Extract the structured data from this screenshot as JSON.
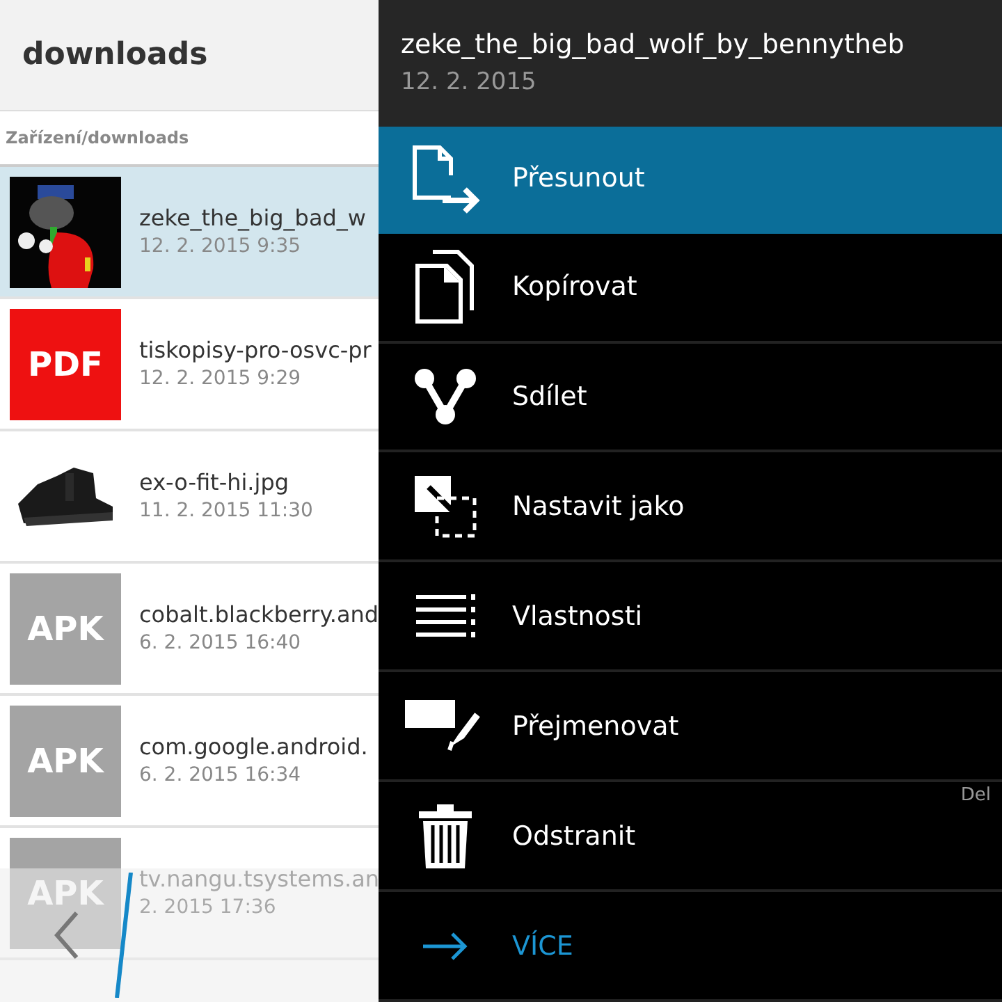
{
  "header": {
    "title": "downloads"
  },
  "breadcrumb": "Zařízení/downloads",
  "files": [
    {
      "kind": "picture",
      "name": "zeke_the_big_bad_w",
      "date": "12. 2. 2015 9:35",
      "selected": true
    },
    {
      "kind": "tile",
      "tile": "PDF",
      "color": "#ee1111",
      "name": "tiskopisy-pro-osvc-pr",
      "date": "12. 2. 2015 9:29",
      "selected": false
    },
    {
      "kind": "picture",
      "name": "ex-o-fit-hi.jpg",
      "date": "11. 2. 2015 11:30",
      "selected": false
    },
    {
      "kind": "tile",
      "tile": "APK",
      "color": "#a4a4a4",
      "name": "cobalt.blackberry.and",
      "date": "6. 2. 2015 16:40",
      "selected": false
    },
    {
      "kind": "tile",
      "tile": "APK",
      "color": "#a4a4a4",
      "name": "com.google.android.",
      "date": "6. 2. 2015 16:34",
      "selected": false
    },
    {
      "kind": "tile",
      "tile": "APK",
      "color": "#a4a4a4",
      "name": "tv.nangu.tsystems.an",
      "date": "2. 2015 17:36",
      "selected": false
    }
  ],
  "menu": {
    "title": "zeke_the_big_bad_wolf_by_bennytheb",
    "date": "12. 2. 2015",
    "items": [
      {
        "kind": "action",
        "label": "Přesunout",
        "selected": true
      },
      {
        "kind": "action",
        "label": "Kopírovat",
        "selected": false
      },
      {
        "kind": "action",
        "label": "Sdílet",
        "selected": false
      },
      {
        "kind": "action",
        "label": "Nastavit jako",
        "selected": false
      },
      {
        "kind": "action",
        "label": "Vlastnosti",
        "selected": false
      },
      {
        "kind": "action",
        "label": "Přejmenovat",
        "selected": false
      },
      {
        "kind": "action",
        "label": "Odstranit",
        "selected": false,
        "shortcut": "Del"
      },
      {
        "kind": "more",
        "label": "VÍCE",
        "selected": false
      }
    ]
  }
}
